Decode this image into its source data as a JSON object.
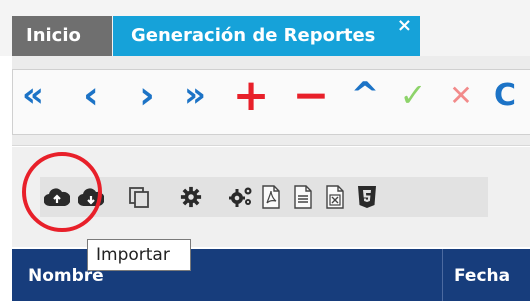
{
  "tabs": [
    {
      "label": "Inicio"
    },
    {
      "label": "Generación de Reportes",
      "close": "×"
    }
  ],
  "nav_toolbar": {
    "first": "«",
    "prev": "‹",
    "next": "›",
    "last": "»",
    "add": "+",
    "remove": "−",
    "up": "^",
    "confirm": "✓",
    "cancel": "✕",
    "refresh": "C"
  },
  "icon_toolbar": {
    "tooltip": "Importar",
    "icons": [
      "cloud-upload-icon",
      "cloud-download-icon",
      "copy-icon",
      "gear-icon",
      "gears-icon",
      "pdf-icon",
      "document-icon",
      "excel-icon",
      "html5-icon"
    ]
  },
  "table": {
    "columns": [
      "Nombre",
      "Fecha"
    ]
  },
  "colors": {
    "active_tab": "#16a2d9",
    "inactive_tab": "#6f6f6f",
    "nav_blue": "#1c73c6",
    "add_red": "#e8202a",
    "confirm_green": "#8dd36a",
    "cancel_red": "#f28a8a",
    "table_header": "#173d7c",
    "highlight_circle": "#e8202a"
  }
}
